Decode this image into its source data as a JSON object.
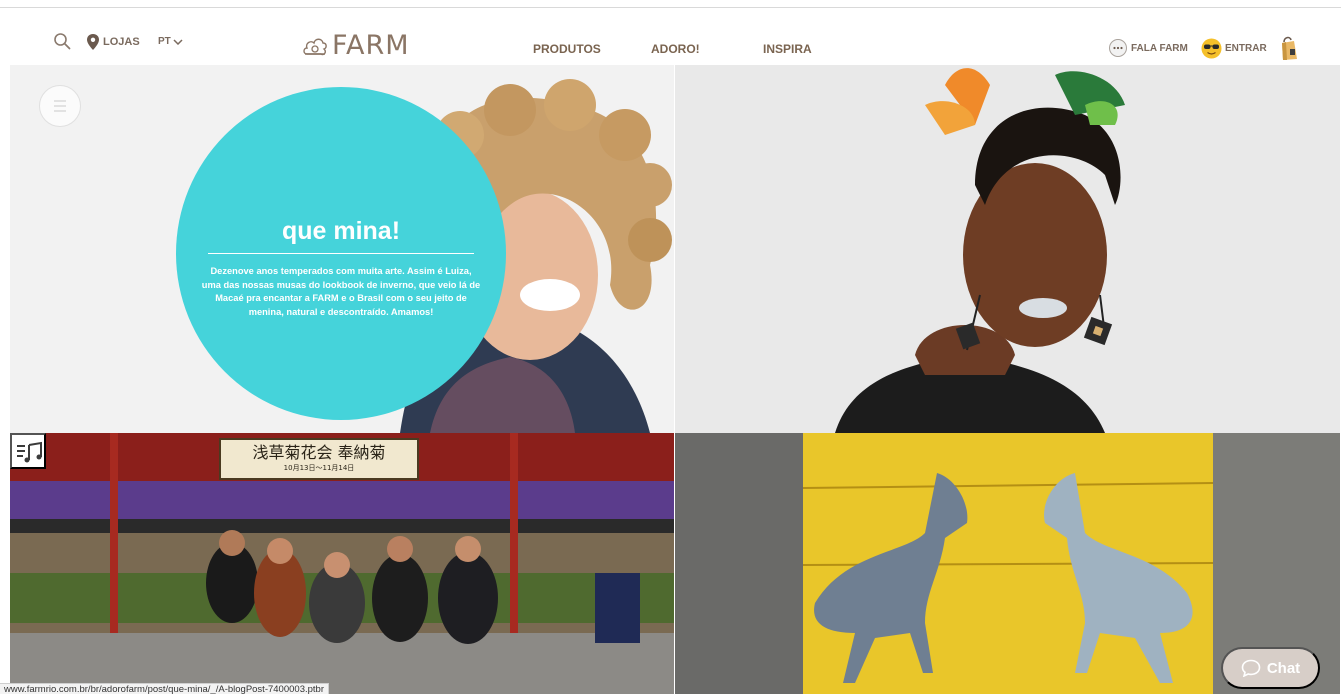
{
  "header": {
    "logo_text": "FARM",
    "stores_label": "LOJAS",
    "language_label": "PT",
    "nav": [
      {
        "label": "PRODUTOS"
      },
      {
        "label": "ADORO!"
      },
      {
        "label": "INSPIRA"
      }
    ],
    "talk_label": "FALA FARM",
    "login_label": "ENTRAR",
    "icons": [
      "search-icon",
      "map-pin-icon",
      "chevron-down-icon",
      "farm-logo-icon",
      "chat-bubble-icon",
      "sunglasses-emoji-icon",
      "shopping-bag-icon"
    ]
  },
  "featured_post": {
    "title": "que mina!",
    "excerpt": "Dezenove anos temperados com muita arte. Assim é Luiza, uma das nossas musas do lookbook de inverno, que veio lá de Macaé pra encantar a FARM e o Brasil com o seu jeito de menina, natural e descontraído. Amamos!",
    "circle_color": "#45d3da"
  },
  "temple_sign": {
    "title": "浅草菊花会 奉納菊",
    "subtitle": "10月13日〜11月14日"
  },
  "status_bar": {
    "url": "www.farmrio.com.br/br/adorofarm/post/que-mina/_/A-blogPost-7400003.ptbr"
  },
  "chat_widget": {
    "label": "Chat"
  },
  "colors": {
    "brand_text": "#7a6450",
    "accent": "#45d3da",
    "chat_bg": "#d7cec8"
  }
}
